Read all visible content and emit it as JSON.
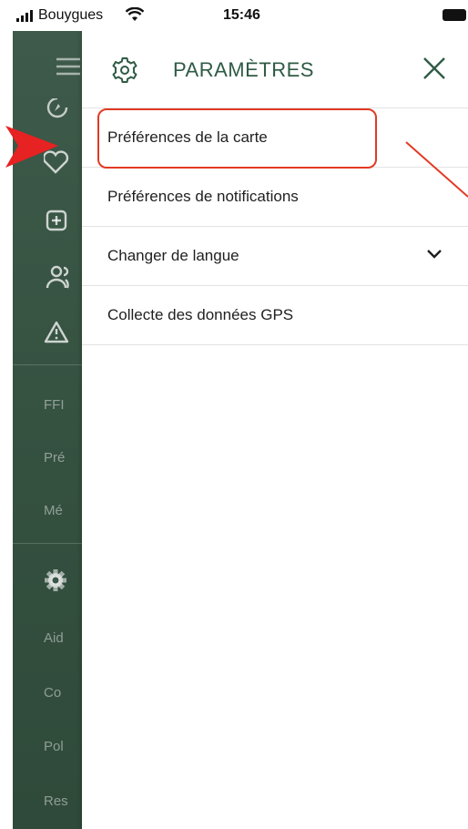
{
  "status_bar": {
    "carrier": "Bouygues",
    "time": "15:46"
  },
  "side_rail": {
    "texts": [
      "FFI",
      "Pré",
      "Mé",
      "Aid",
      "Co",
      "Pol",
      "Res"
    ]
  },
  "drawer": {
    "title": "PARAMÈTRES",
    "items": [
      {
        "label": "Préférences de la carte"
      },
      {
        "label": "Préférences de notifications"
      },
      {
        "label": "Changer de langue"
      },
      {
        "label": "Collecte des données GPS"
      }
    ]
  },
  "colors": {
    "brand_green": "#2f5b45",
    "rail_green": "#3a5646",
    "annotation_red": "#e23a24"
  }
}
